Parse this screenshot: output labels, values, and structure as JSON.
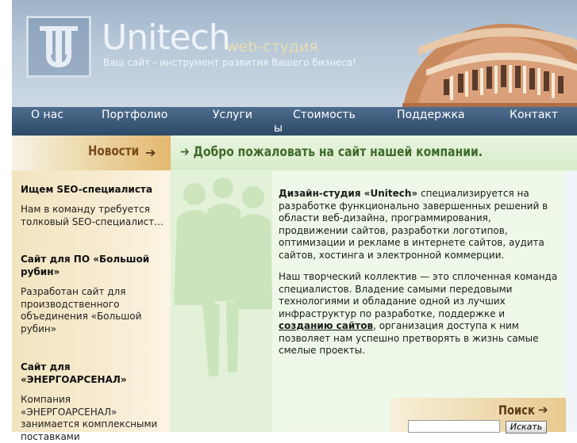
{
  "header": {
    "brand": "Unitech",
    "brand_sub": "web-студия",
    "slogan": "Ваш сайт - инструмент развития Вашего бизнеса!"
  },
  "nav": {
    "items": [
      "О нас",
      "Портфолио",
      "Услуги",
      "Стоимость",
      "Поддержка",
      "Контакт",
      "ы"
    ]
  },
  "news": {
    "title": "Новости",
    "items": [
      {
        "title": "Ищем SEO-специалиста",
        "text": "Нам в команду требуется толковый SEO-специалист..."
      },
      {
        "title": "Сайт для ПО «Большой рубин»",
        "text": "Разработан сайт для производственного объединения «Большой рубин»"
      },
      {
        "title": "Сайт для «ЭНЕРГОАРСЕНАЛ»",
        "text": "Компания «ЭНЕРГОАРСЕНАЛ» занимается комплексными поставками"
      }
    ]
  },
  "main": {
    "title": "Добро пожаловать на сайт нашей компании.",
    "p1_strong": "Дизайн-студия «Unitech»",
    "p1_rest": " специализируется на разработке функционально завершенных решений в области веб-дизайна, программирования, продвижении сайтов, разработки логотипов, оптимизации и рекламе в интернете сайтов, аудита сайтов, хостинга и электронной коммерции.",
    "p2_before": "Наш творческий коллектив — это сплоченная команда специалистов. Владение самыми передовыми технологиями и обладание одной из лучших инфраструктур по разработке, поддержке и ",
    "p2_link": "созданию сайтов",
    "p2_after": ", организация доступа к ним позволяет нам успешно претворять в жизнь самые смелые проекты."
  },
  "search": {
    "title": "Поиск",
    "placeholder": "",
    "button": "Искать"
  },
  "colors": {
    "nav_bg": "#3a5878",
    "left_bg": "#f2e4bf",
    "main_bg": "#eef8e8",
    "title_green": "#3e6b2a",
    "news_brown": "#7a4a1a"
  },
  "icons": [
    "logo-u-icon",
    "arrow-left-icon",
    "arrow-right-icon",
    "building-image"
  ]
}
